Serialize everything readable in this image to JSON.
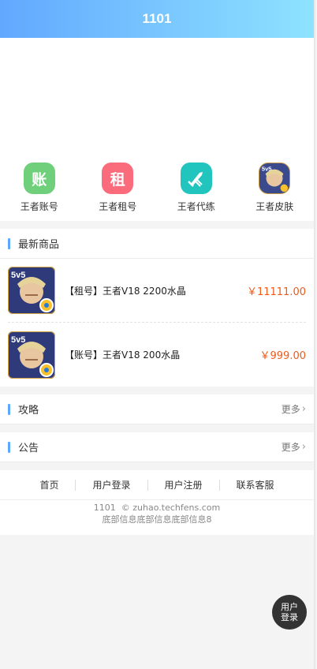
{
  "header": {
    "title": "1101"
  },
  "categories": [
    {
      "label": "王者账号",
      "icon_char": "账",
      "color": "#6fcf7a"
    },
    {
      "label": "王者租号",
      "icon_char": "租",
      "color": "#fa6b7c"
    },
    {
      "label": "王者代练",
      "icon_char": "",
      "color": "#22c5be"
    },
    {
      "label": "王者皮肤",
      "icon_char": "",
      "color": "#b8863a"
    }
  ],
  "sections": {
    "latest": {
      "title": "最新商品"
    },
    "guides": {
      "title": "攻略",
      "more": "更多"
    },
    "notices": {
      "title": "公告",
      "more": "更多"
    }
  },
  "products": [
    {
      "name": "【租号】王者V18 2200水晶",
      "price": "￥11111.00"
    },
    {
      "name": "【账号】王者V18 200水晶",
      "price": "￥999.00"
    }
  ],
  "footer": {
    "links": [
      "首页",
      "用户登录",
      "用户注册",
      "联系客服"
    ],
    "copyright": "1101  © zuhao.techfens.com",
    "info": "底部信息底部信息底部信息8"
  },
  "float_button": {
    "line1": "用户",
    "line2": "登录"
  }
}
